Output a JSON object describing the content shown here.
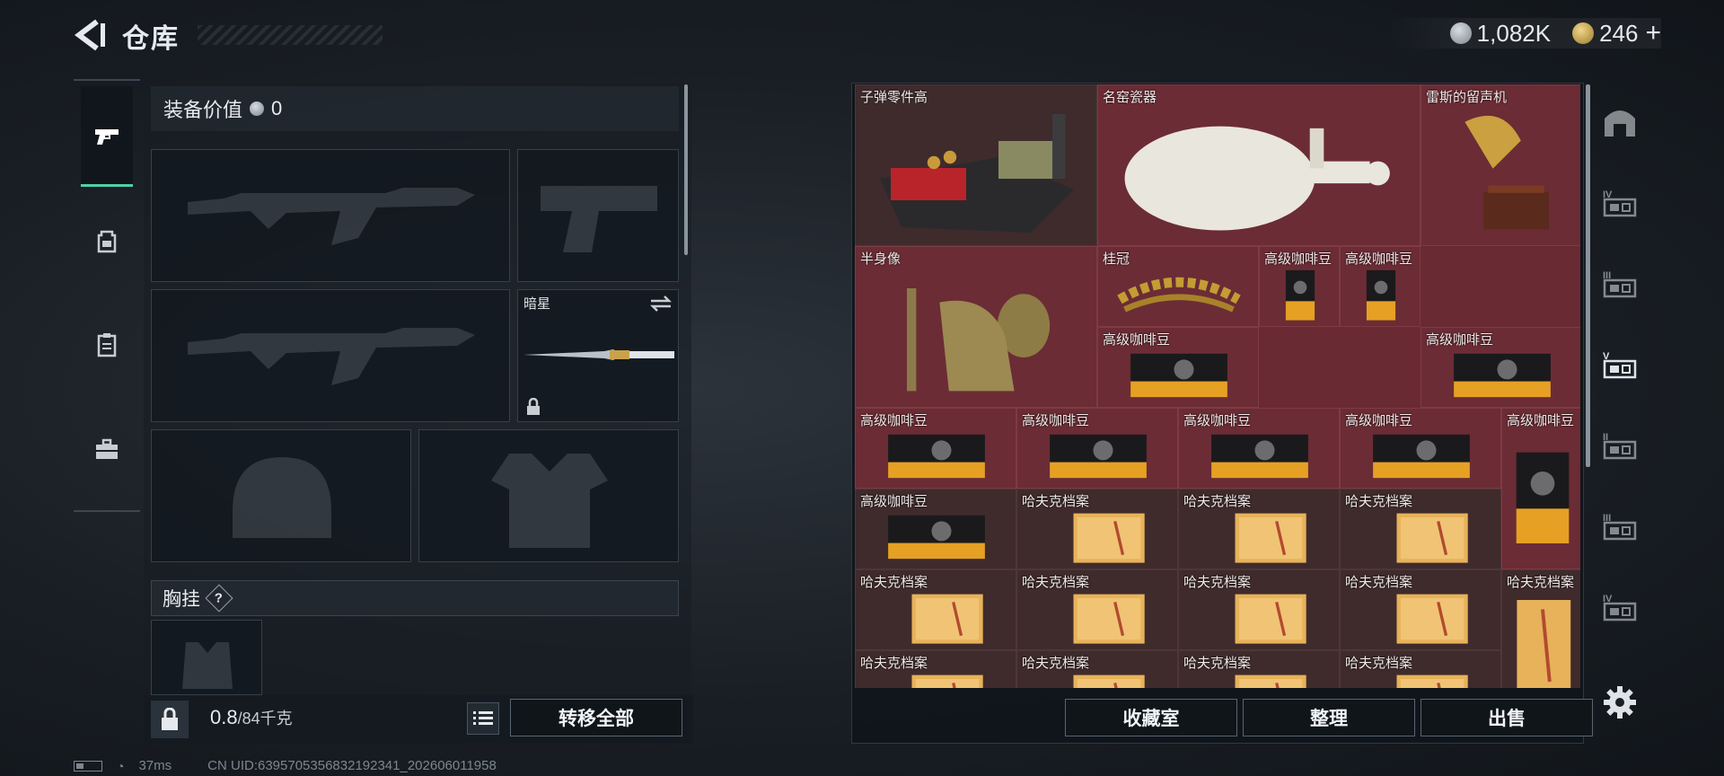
{
  "header": {
    "title": "仓库"
  },
  "currency": {
    "silver_amount": "1,082K",
    "gold_amount": "246",
    "plus_label": "+"
  },
  "left_rail": {
    "items": [
      {
        "icon": "pistol-icon",
        "active": true
      },
      {
        "icon": "backpack-icon",
        "active": false
      },
      {
        "icon": "clipboard-icon",
        "active": false
      },
      {
        "icon": "toolbox-icon",
        "active": false
      }
    ]
  },
  "loadout": {
    "equip_value_label": "装备价值",
    "equip_value": "0",
    "melee_name": "暗星",
    "chest_rig_label": "胸挂",
    "chest_rig_help": "?"
  },
  "weight": {
    "current": "0.8",
    "max_unit": "/84千克"
  },
  "buttons": {
    "transfer_all": "转移全部",
    "collection": "收藏室",
    "organize": "整理",
    "sell": "出售"
  },
  "storage": {
    "item_names": {
      "ammo_parts": "子弹零件高",
      "porcelain": "名窑瓷器",
      "gramophone": "雷斯的留声机",
      "bust": "半身像",
      "laurel": "桂冠",
      "coffee": "高级咖啡豆",
      "harvk_file": "哈夫克档案"
    }
  },
  "right_rail": {
    "items": [
      {
        "icon": "arch-icon",
        "level": ""
      },
      {
        "icon": "storage-iv-icon",
        "level": "IV"
      },
      {
        "icon": "storage-iii-icon",
        "level": "III"
      },
      {
        "icon": "storage-v-icon",
        "level": "V"
      },
      {
        "icon": "storage-ii-icon",
        "level": "II"
      },
      {
        "icon": "storage-iii-b-icon",
        "level": "III"
      },
      {
        "icon": "storage-iv-b-icon",
        "level": "IV"
      }
    ]
  },
  "status": {
    "ping": "37ms",
    "uid": "CN UID:6395705356832192341_202606011958"
  },
  "colors": {
    "accent": "#4fd1a5",
    "grid_red": "#6b2c35",
    "grid_dark": "#3f2b2c"
  }
}
